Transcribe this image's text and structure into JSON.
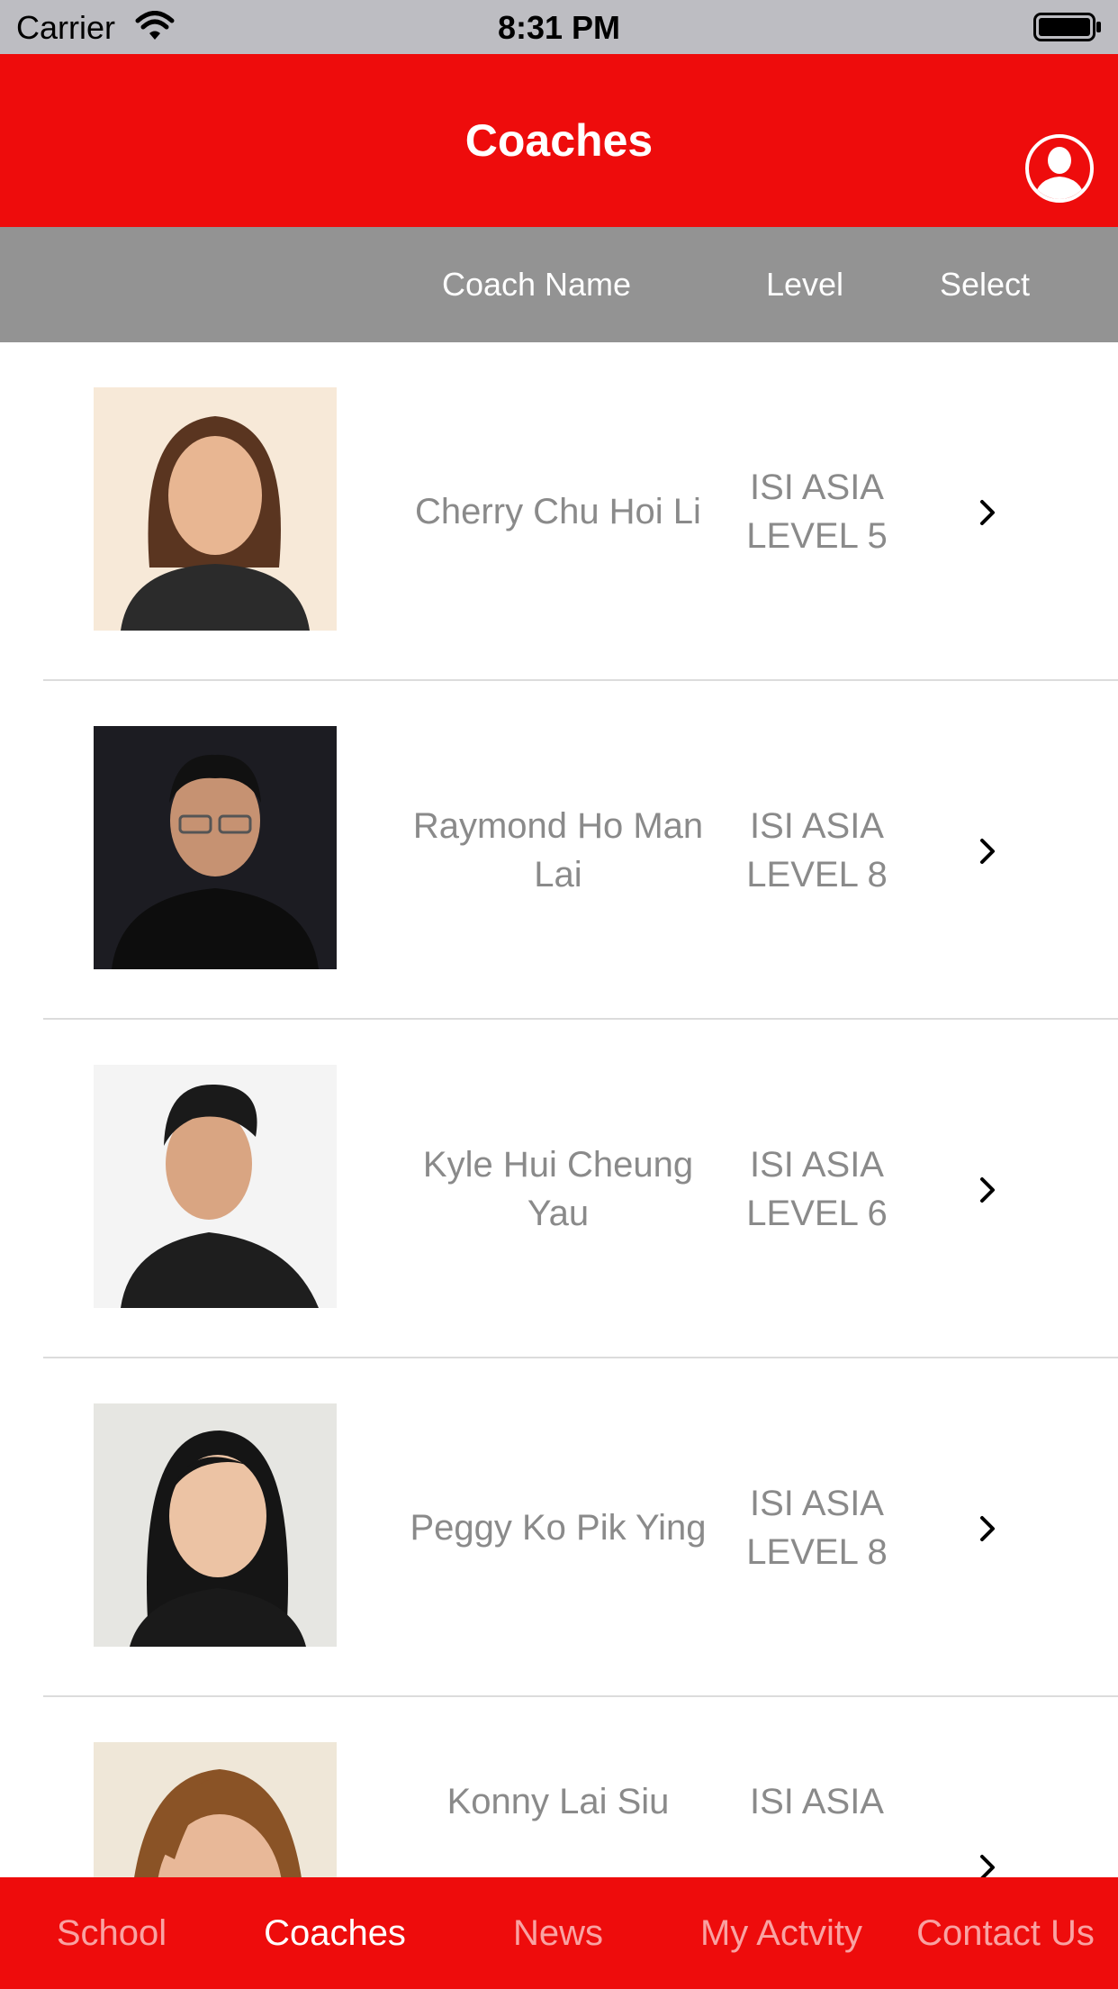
{
  "status_bar": {
    "carrier": "Carrier",
    "time": "8:31 PM"
  },
  "nav": {
    "title": "Coaches"
  },
  "table_header": {
    "name": "Coach Name",
    "level": "Level",
    "select": "Select"
  },
  "coaches": [
    {
      "name": "Cherry Chu Hoi Li",
      "level": "ISI ASIA LEVEL 5"
    },
    {
      "name": "Raymond Ho Man Lai",
      "level": "ISI ASIA LEVEL 8"
    },
    {
      "name": "Kyle Hui Cheung Yau",
      "level": "ISI ASIA LEVEL 6"
    },
    {
      "name": "Peggy Ko Pik Ying",
      "level": "ISI ASIA LEVEL 8"
    },
    {
      "name": "Konny Lai Siu",
      "level": "ISI ASIA"
    }
  ],
  "tabs": [
    {
      "label": "School",
      "active": false
    },
    {
      "label": "Coaches",
      "active": true
    },
    {
      "label": "News",
      "active": false
    },
    {
      "label": "My Actvity",
      "active": false
    },
    {
      "label": "Contact Us",
      "active": false
    }
  ],
  "colors": {
    "brand_red": "#ee0c0c",
    "header_gray": "#939393",
    "text_gray": "#8a8a8a"
  }
}
